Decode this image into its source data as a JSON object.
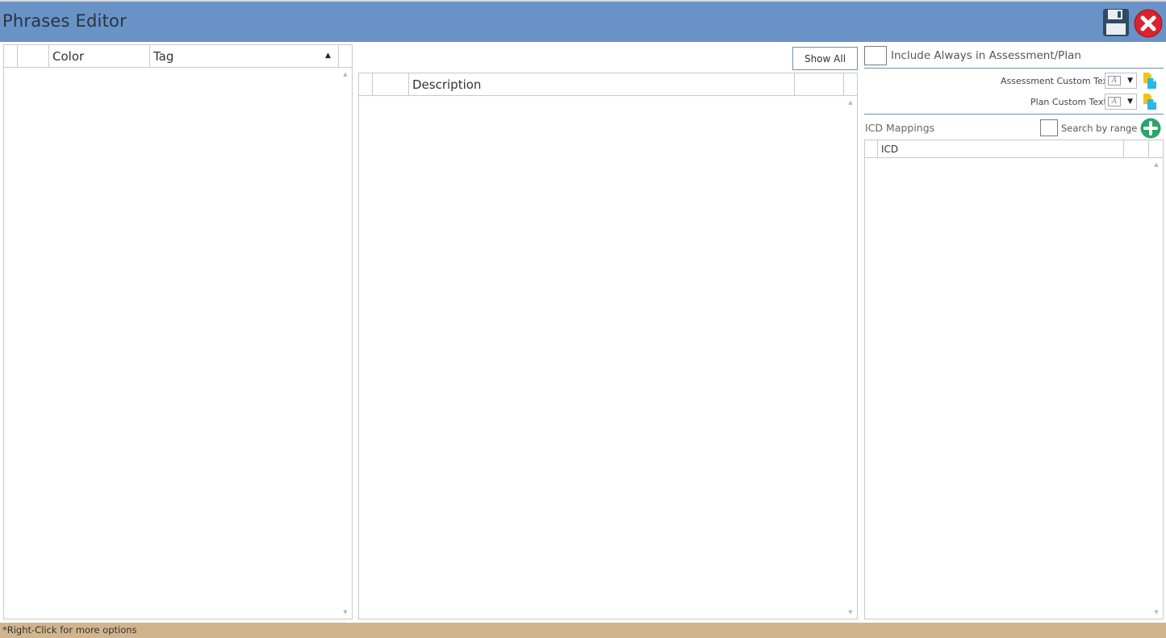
{
  "window": {
    "title": "Phrases Editor"
  },
  "icons": {
    "save": "floppy-disk-icon",
    "close": "red-close-icon",
    "add": "green-plus-icon",
    "custom_text": "document-icon"
  },
  "colors": {
    "titlebar": "#6993c7",
    "statusbar": "#d2b48c",
    "add_button": "#2ea36a",
    "close_button": "#d9232d"
  },
  "tags_grid": {
    "columns": [
      {
        "label": ""
      },
      {
        "label": ""
      },
      {
        "label": "Color"
      },
      {
        "label": "Tag"
      },
      {
        "label": ""
      }
    ],
    "sort_column": "Tag",
    "sort_direction": "ascending",
    "rows": []
  },
  "phrases_grid": {
    "show_all_label": "Show All",
    "columns": [
      {
        "label": ""
      },
      {
        "label": ""
      },
      {
        "label": "Description"
      },
      {
        "label": ""
      },
      {
        "label": ""
      }
    ],
    "rows": []
  },
  "options": {
    "include_always_label": "Include Always in Assessment/Plan",
    "include_always_checked": false,
    "assessment_custom_text_label": "Assessment Custom Text:",
    "plan_custom_text_label": "Plan Custom Text:"
  },
  "icd": {
    "section_label": "ICD Mappings",
    "search_by_range_label": "Search by range",
    "search_by_range_checked": false,
    "columns": [
      {
        "label": ""
      },
      {
        "label": "ICD"
      },
      {
        "label": ""
      },
      {
        "label": ""
      }
    ],
    "rows": []
  },
  "status": {
    "text": "*Right-Click for more options"
  }
}
